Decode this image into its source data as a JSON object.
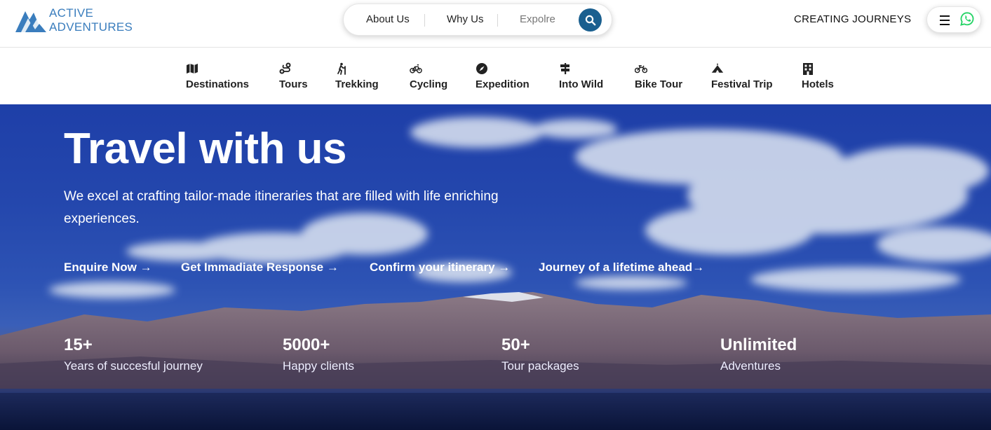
{
  "brand": {
    "line1": "ACTIVE",
    "line2": "ADVENTURES",
    "color": "#3a7dbd"
  },
  "pill_nav": {
    "about": "About Us",
    "why": "Why Us",
    "explore": "Expolre"
  },
  "header": {
    "creating": "CREATING JOURNEYS"
  },
  "categories": [
    {
      "label": "Destinations",
      "icon": "map-icon"
    },
    {
      "label": "Tours",
      "icon": "route-icon"
    },
    {
      "label": "Trekking",
      "icon": "hiker-icon"
    },
    {
      "label": "Cycling",
      "icon": "bicycle-icon"
    },
    {
      "label": "Expedition",
      "icon": "compass-icon"
    },
    {
      "label": "Into Wild",
      "icon": "signpost-icon"
    },
    {
      "label": "Bike Tour",
      "icon": "motorbike-icon"
    },
    {
      "label": "Festival Trip",
      "icon": "festival-tent-icon"
    },
    {
      "label": "Hotels",
      "icon": "hotel-icon"
    }
  ],
  "hero": {
    "title": "Travel with us",
    "description": "We excel at crafting tailor-made itineraries that are filled with life enriching experiences.",
    "ctas": [
      "Enquire Now →",
      "Get Immadiate Response →",
      "Confirm your itinerary →",
      "Journey of a lifetime ahead→"
    ],
    "stats": [
      {
        "value": "15+",
        "label": "Years of succesful journey"
      },
      {
        "value": "5000+",
        "label": "Happy clients"
      },
      {
        "value": "50+",
        "label": "Tour packages"
      },
      {
        "value": "Unlimited",
        "label": "Adventures"
      }
    ]
  },
  "colors": {
    "search_button": "#1a5f8f",
    "whatsapp": "#25d366",
    "sky": "#2447ad"
  }
}
